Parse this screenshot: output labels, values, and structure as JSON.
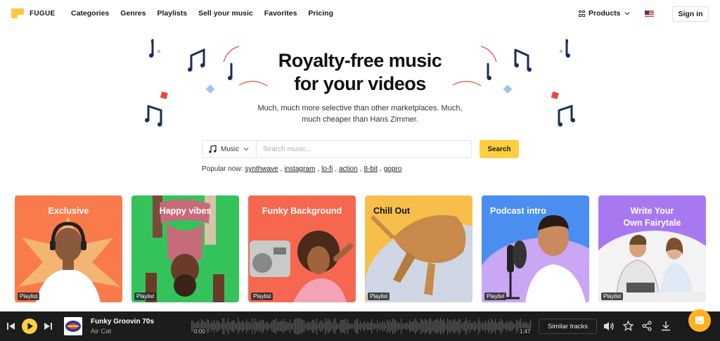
{
  "brand": {
    "name": "FUGUE"
  },
  "nav": [
    {
      "label": "Categories"
    },
    {
      "label": "Genres"
    },
    {
      "label": "Playlists"
    },
    {
      "label": "Sell your music"
    },
    {
      "label": "Favorites"
    },
    {
      "label": "Pricing"
    }
  ],
  "header": {
    "products_label": "Products",
    "signin_label": "Sign in"
  },
  "hero": {
    "title_line1": "Royalty-free music",
    "title_line2": "for your videos",
    "subtitle_line1": "Much, much more selective than other marketplaces. Much,",
    "subtitle_line2": "much cheaper than Hans Zimmer."
  },
  "search": {
    "type_label": "Music",
    "placeholder": "Search music...",
    "button_label": "Search",
    "popular_label": "Popular now:",
    "popular_tags": [
      "synthwave",
      "instagram",
      "lo-fi",
      "action",
      "8-bit",
      "gopro"
    ]
  },
  "cards": [
    {
      "title": "Exclusive",
      "badge": "Playlist",
      "color": "#f97b4b"
    },
    {
      "title": "Happy vibes",
      "badge": "Playlist",
      "color": "#34c35a"
    },
    {
      "title": "Funky Background",
      "badge": "Playlist",
      "color": "#f5684f"
    },
    {
      "title": "Chill Out",
      "badge": "Playlist",
      "color": "#f7be4a"
    },
    {
      "title": "Podcast intro",
      "badge": "Playlist",
      "color": "#4a8ef0"
    },
    {
      "title": "Write Your Own Fairytale",
      "title_line1": "Write Your",
      "title_line2": "Own Fairytale",
      "badge": "Playlist",
      "color": "#a878f0"
    }
  ],
  "player": {
    "track_title": "Funky Groovin 70s",
    "artist": "Air Cat",
    "time_current": "0:00",
    "time_total": "1:47",
    "similar_label": "Similar tracks",
    "progress": 0
  },
  "colors": {
    "accent": "#ffcf40",
    "player_bg": "#1c1c1c",
    "note_color": "#1f2a5c"
  }
}
